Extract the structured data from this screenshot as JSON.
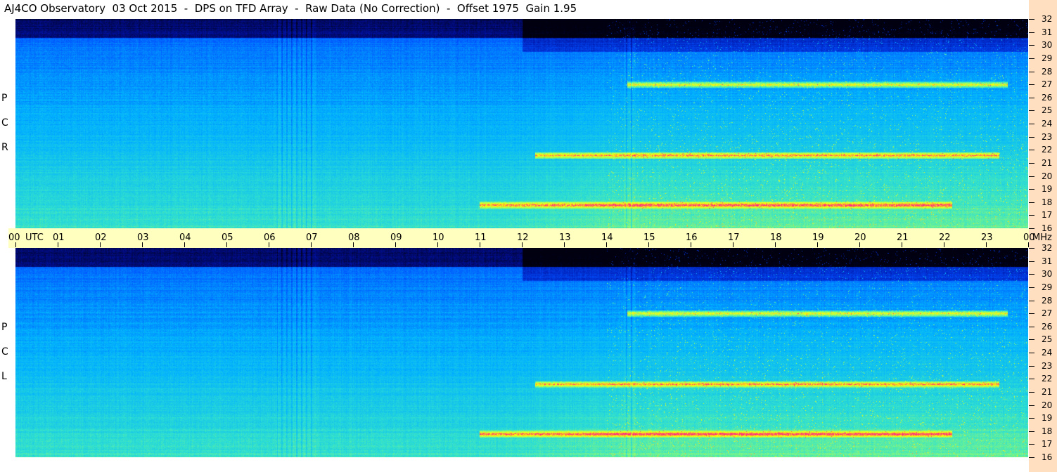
{
  "title": "AJ4CO Observatory  03 Oct 2015  -  DPS on TFD Array  -  Raw Data (No Correction)  -  Offset 1975  Gain 1.95",
  "panels": [
    {
      "name": "rcp",
      "letters": [
        "R",
        "C",
        "P"
      ]
    },
    {
      "name": "lcp",
      "letters": [
        "L",
        "C",
        "P"
      ]
    }
  ],
  "x_axis": {
    "tick_labels": [
      "00",
      "01",
      "02",
      "03",
      "04",
      "05",
      "06",
      "07",
      "08",
      "09",
      "10",
      "11",
      "12",
      "13",
      "14",
      "15",
      "16",
      "17",
      "18",
      "19",
      "20",
      "21",
      "22",
      "23",
      "00"
    ],
    "utc_label": "UTC",
    "end_unit": "MHz"
  },
  "y_axis": {
    "tick_labels": [
      "32",
      "31",
      "30",
      "29",
      "28",
      "27",
      "26",
      "25",
      "24",
      "23",
      "22",
      "21",
      "20",
      "19",
      "18",
      "17",
      "16"
    ]
  },
  "colors": {
    "right_bar": "#ffdfc0",
    "time_bar": "#ffffc0"
  },
  "chart_data": {
    "type": "heatmap",
    "title": "AJ4CO Observatory  03 Oct 2015  -  DPS on TFD Array  -  Raw Data (No Correction)  -  Offset 1975  Gain 1.95",
    "x_unit": "UTC hour",
    "y_unit": "MHz",
    "xlim": [
      0,
      24
    ],
    "ylim": [
      16,
      32
    ],
    "panels": [
      "RCP",
      "LCP"
    ],
    "colormap": [
      "#000010",
      "#0010a0",
      "#0050ff",
      "#00b0ff",
      "#30e0d0",
      "#a0ff60",
      "#ffff00",
      "#ff3080"
    ],
    "noted_features": [
      {
        "kind": "vertical_band",
        "utc": [
          6.2,
          7.1
        ]
      },
      {
        "kind": "vertical_band",
        "utc": [
          14.4,
          14.7
        ]
      },
      {
        "kind": "horizontal_band",
        "mhz": 27,
        "utc": [
          14.5,
          23.5
        ]
      },
      {
        "kind": "horizontal_band",
        "mhz": 21.6,
        "utc": [
          12.3,
          23.3
        ]
      },
      {
        "kind": "horizontal_band",
        "mhz": 17.8,
        "utc": [
          11.0,
          22.2
        ]
      }
    ]
  }
}
